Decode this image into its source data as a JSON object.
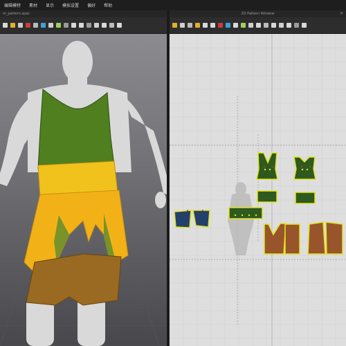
{
  "menubar": {
    "items": [
      "编辑模特",
      "素材",
      "显示",
      "模拟设置",
      "偏好",
      "帮助"
    ]
  },
  "viewport3d": {
    "file_name": "m_pattern.zpac"
  },
  "pattern_window": {
    "title": "2D Pattern Window"
  },
  "colors": {
    "shirt": "#4f7f1f",
    "belt": "#f2c21c",
    "skirt": "#f2b217",
    "shorts": "#9a6a22",
    "pattern_blue": "#23406a",
    "pattern_brown": "#98552c",
    "pattern_green": "#2e5a1f",
    "pattern_outline": "#e3e31c",
    "skin": "#d9d9d9"
  },
  "icons": [
    "cursor-icon",
    "move-icon",
    "rotate-icon",
    "pattern-tool-icon",
    "sew-tool-icon",
    "pin-icon",
    "fold-icon",
    "texture-icon",
    "avatar-icon",
    "measure-icon"
  ]
}
